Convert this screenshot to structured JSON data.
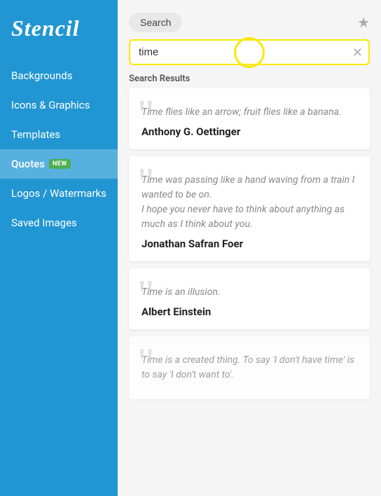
{
  "sidebar": {
    "logo": "Stencil",
    "items": [
      {
        "id": "backgrounds",
        "label": "Backgrounds",
        "active": false
      },
      {
        "id": "icons-graphics",
        "label": "Icons & Graphics",
        "active": false
      },
      {
        "id": "templates",
        "label": "Templates",
        "active": false
      },
      {
        "id": "quotes",
        "label": "Quotes",
        "active": true,
        "badge": "NEW"
      },
      {
        "id": "logos-watermarks",
        "label": "Logos / Watermarks",
        "active": false
      },
      {
        "id": "saved-images",
        "label": "Saved Images",
        "active": false
      }
    ]
  },
  "header": {
    "search_tab_label": "Search",
    "star_icon": "★"
  },
  "search": {
    "value": "time",
    "placeholder": "Search",
    "clear_icon": "✕"
  },
  "results": {
    "label": "Search Results",
    "items": [
      {
        "id": "result-1",
        "quote": "Time flies like an arrow; fruit flies like a banana.",
        "author": "Anthony G. Oettinger"
      },
      {
        "id": "result-2",
        "quote": "Time was passing like a hand waving from a train I wanted to be on.\nI hope you never have to think about anything as much as I think about you.",
        "author": "Jonathan Safran Foer"
      },
      {
        "id": "result-3",
        "quote": "Time is an illusion.",
        "author": "Albert Einstein"
      },
      {
        "id": "result-4",
        "quote": "Time is a created thing. To say 'I don't have time' is to say 'I don't want to'.",
        "author": ""
      }
    ]
  }
}
